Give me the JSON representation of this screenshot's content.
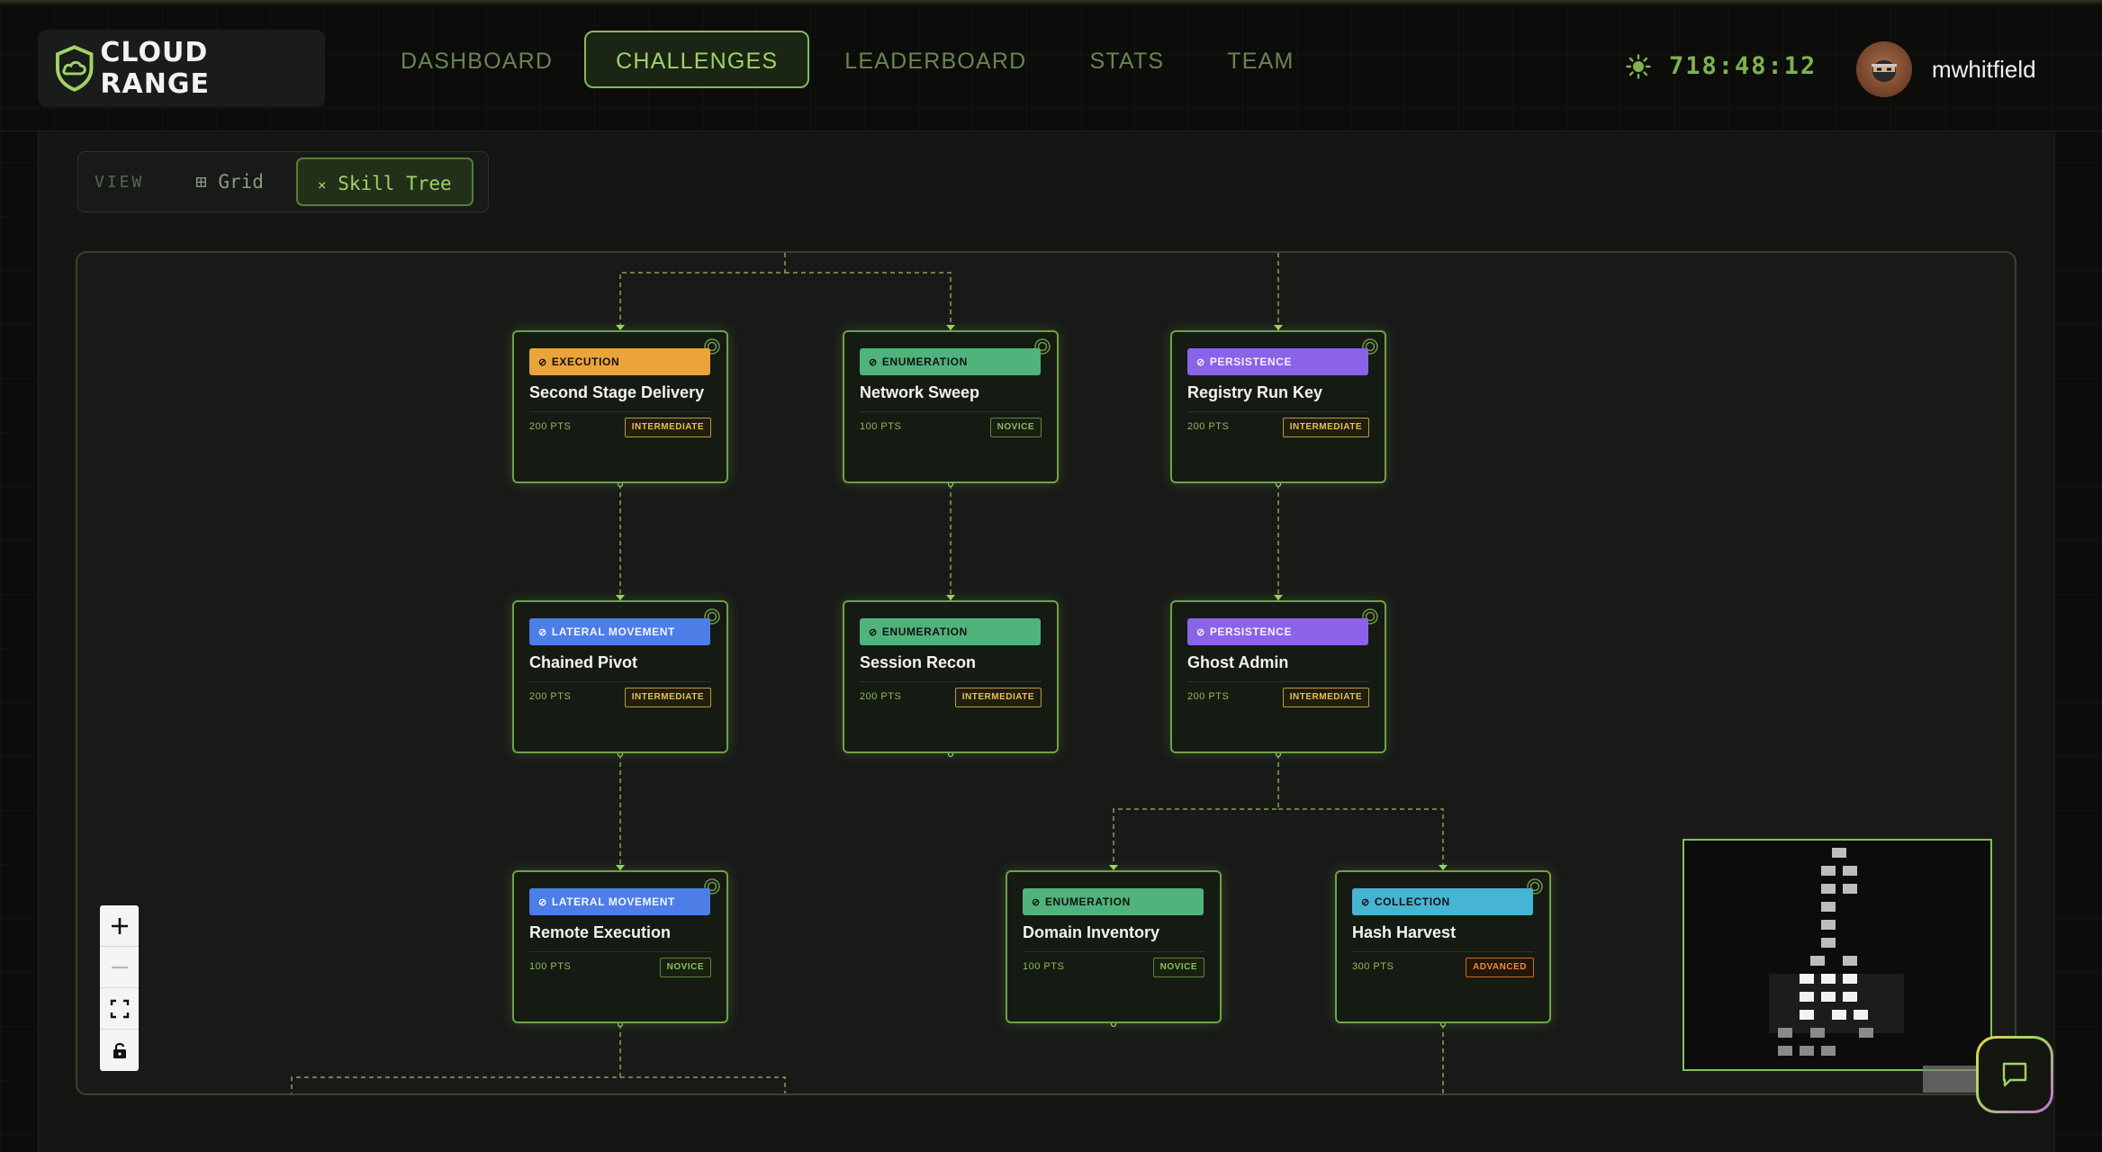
{
  "app": {
    "brand": "CLOUD RANGE"
  },
  "nav": {
    "items": [
      {
        "label": "DASHBOARD",
        "active": false
      },
      {
        "label": "CHALLENGES",
        "active": true
      },
      {
        "label": "LEADERBOARD",
        "active": false
      },
      {
        "label": "STATS",
        "active": false
      },
      {
        "label": "TEAM",
        "active": false
      }
    ]
  },
  "timer": {
    "value": "718:48:12",
    "icon": "sun-icon"
  },
  "user": {
    "name": "mwhitfield"
  },
  "view": {
    "label": "VIEW",
    "options": [
      {
        "label": "Grid",
        "icon": "⊞",
        "active": false
      },
      {
        "label": "Skill Tree",
        "icon": "×",
        "active": true
      }
    ]
  },
  "nodes": [
    {
      "category": "EXECUTION",
      "title": "Second Stage Delivery",
      "points": "200 PTS",
      "level": "INTERMEDIATE"
    },
    {
      "category": "ENUMERATION",
      "title": "Network Sweep",
      "points": "100 PTS",
      "level": "NOVICE"
    },
    {
      "category": "PERSISTENCE",
      "title": "Registry Run Key",
      "points": "200 PTS",
      "level": "INTERMEDIATE"
    },
    {
      "category": "LATERAL MOVEMENT",
      "title": "Chained Pivot",
      "points": "200 PTS",
      "level": "INTERMEDIATE"
    },
    {
      "category": "ENUMERATION",
      "title": "Session Recon",
      "points": "200 PTS",
      "level": "INTERMEDIATE"
    },
    {
      "category": "PERSISTENCE",
      "title": "Ghost Admin",
      "points": "200 PTS",
      "level": "INTERMEDIATE"
    },
    {
      "category": "LATERAL MOVEMENT",
      "title": "Remote Execution",
      "points": "100 PTS",
      "level": "NOVICE"
    },
    {
      "category": "ENUMERATION",
      "title": "Domain Inventory",
      "points": "100 PTS",
      "level": "NOVICE"
    },
    {
      "category": "COLLECTION",
      "title": "Hash Harvest",
      "points": "300 PTS",
      "level": "ADVANCED"
    }
  ],
  "colors": {
    "accent": "#9fd26a",
    "execution": "#eaa43a",
    "enumeration": "#4fb37c",
    "persistence": "#8a63e8",
    "lateral_movement": "#4d7ee8",
    "collection": "#46b5d4"
  }
}
